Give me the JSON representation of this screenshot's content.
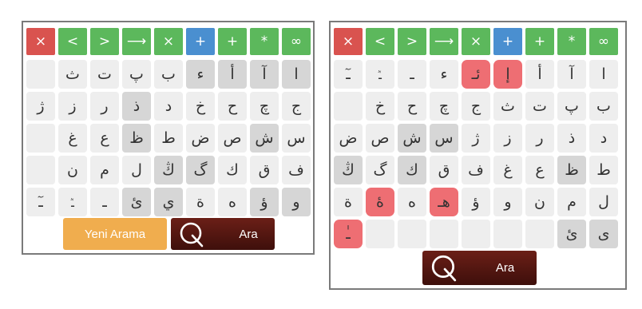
{
  "toolbar": [
    {
      "label": "×",
      "name": "close-button",
      "color": "red"
    },
    {
      "label": "<",
      "name": "move-left-button",
      "color": "green"
    },
    {
      "label": ">",
      "name": "move-right-button",
      "color": "green"
    },
    {
      "label": "⟶",
      "name": "arrow-button",
      "color": "green"
    },
    {
      "label": "×",
      "name": "clear-button",
      "color": "green"
    },
    {
      "label": "+",
      "name": "add-button",
      "color": "blue"
    },
    {
      "label": "+",
      "name": "plus-button",
      "color": "green"
    },
    {
      "label": "*",
      "name": "wildcard-button",
      "color": "green"
    },
    {
      "label": "∞",
      "name": "infinity-button",
      "color": "green"
    }
  ],
  "panel1": {
    "keys": [
      [
        {
          "c": ""
        },
        {
          "c": "ث"
        },
        {
          "c": "ت"
        },
        {
          "c": "پ"
        },
        {
          "c": "ب"
        },
        {
          "c": "ء",
          "d": true
        },
        {
          "c": "أ",
          "d": true
        },
        {
          "c": "آ",
          "d": true
        },
        {
          "c": "ا",
          "d": true
        }
      ],
      [
        {
          "c": "ژ"
        },
        {
          "c": "ز"
        },
        {
          "c": "ر"
        },
        {
          "c": "ذ",
          "d": true
        },
        {
          "c": "د"
        },
        {
          "c": "خ"
        },
        {
          "c": "ح"
        },
        {
          "c": "چ"
        },
        {
          "c": "ج"
        }
      ],
      [
        {
          "c": ""
        },
        {
          "c": "غ"
        },
        {
          "c": "ع"
        },
        {
          "c": "ظ",
          "d": true
        },
        {
          "c": "ط"
        },
        {
          "c": "ض"
        },
        {
          "c": "ص"
        },
        {
          "c": "ش",
          "d": true
        },
        {
          "c": "س"
        }
      ],
      [
        {
          "c": ""
        },
        {
          "c": "ن"
        },
        {
          "c": "م"
        },
        {
          "c": "ل"
        },
        {
          "c": "ڭ",
          "d": true
        },
        {
          "c": "گ",
          "d": true
        },
        {
          "c": "ك"
        },
        {
          "c": "ق"
        },
        {
          "c": "ف"
        }
      ],
      [
        {
          "c": "ـٓ"
        },
        {
          "c": "ـٞ"
        },
        {
          "c": "ـ"
        },
        {
          "c": "ئ",
          "d": true
        },
        {
          "c": "ي",
          "d": true
        },
        {
          "c": "ة"
        },
        {
          "c": "ه"
        },
        {
          "c": "ؤ",
          "d": true
        },
        {
          "c": "و",
          "d": true
        }
      ]
    ],
    "new_search_label": "Yeni Arama",
    "search_label": "Ara"
  },
  "panel2": {
    "keys": [
      [
        {
          "c": "ـٓ"
        },
        {
          "c": "ـٞ"
        },
        {
          "c": "ـ"
        },
        {
          "c": "ء"
        },
        {
          "c": "ئـ",
          "h": true
        },
        {
          "c": "إ",
          "h": true
        },
        {
          "c": "أ"
        },
        {
          "c": "آ"
        },
        {
          "c": "ا"
        }
      ],
      [
        {
          "c": ""
        },
        {
          "c": "خ"
        },
        {
          "c": "ح"
        },
        {
          "c": "چ"
        },
        {
          "c": "ج"
        },
        {
          "c": "ث"
        },
        {
          "c": "ت"
        },
        {
          "c": "پ"
        },
        {
          "c": "ب"
        }
      ],
      [
        {
          "c": "ض"
        },
        {
          "c": "ص"
        },
        {
          "c": "ش",
          "d": true
        },
        {
          "c": "س",
          "d": true
        },
        {
          "c": "ژ"
        },
        {
          "c": "ز"
        },
        {
          "c": "ر"
        },
        {
          "c": "ذ"
        },
        {
          "c": "د"
        }
      ],
      [
        {
          "c": "ڭ",
          "d": true
        },
        {
          "c": "گ"
        },
        {
          "c": "ك",
          "d": true
        },
        {
          "c": "ق"
        },
        {
          "c": "ف"
        },
        {
          "c": "غ"
        },
        {
          "c": "ع"
        },
        {
          "c": "ظ",
          "d": true
        },
        {
          "c": "ط"
        }
      ],
      [
        {
          "c": "ة"
        },
        {
          "c": "ۀ",
          "h": true
        },
        {
          "c": "ه"
        },
        {
          "c": "هـ",
          "h": true
        },
        {
          "c": "ؤ"
        },
        {
          "c": "و"
        },
        {
          "c": "ن"
        },
        {
          "c": "م"
        },
        {
          "c": "ل"
        }
      ],
      [
        {
          "c": "ـٰ",
          "h": true
        },
        {
          "c": ""
        },
        {
          "c": ""
        },
        {
          "c": ""
        },
        {
          "c": ""
        },
        {
          "c": ""
        },
        {
          "c": ""
        },
        {
          "c": "ئ",
          "d": true
        },
        {
          "c": "ى",
          "d": true
        }
      ]
    ],
    "search_label": "Ara"
  },
  "colors": {
    "red": "#d9534f",
    "green": "#5cb85c",
    "blue": "#4a8fd0",
    "key": "#eeeeee",
    "key_dark": "#d6d6d6",
    "highlight": "#ee6e73",
    "yellow": "#f0ad4e",
    "dark_red": "#5a1912"
  },
  "icons": {
    "search": "search-q-icon"
  }
}
